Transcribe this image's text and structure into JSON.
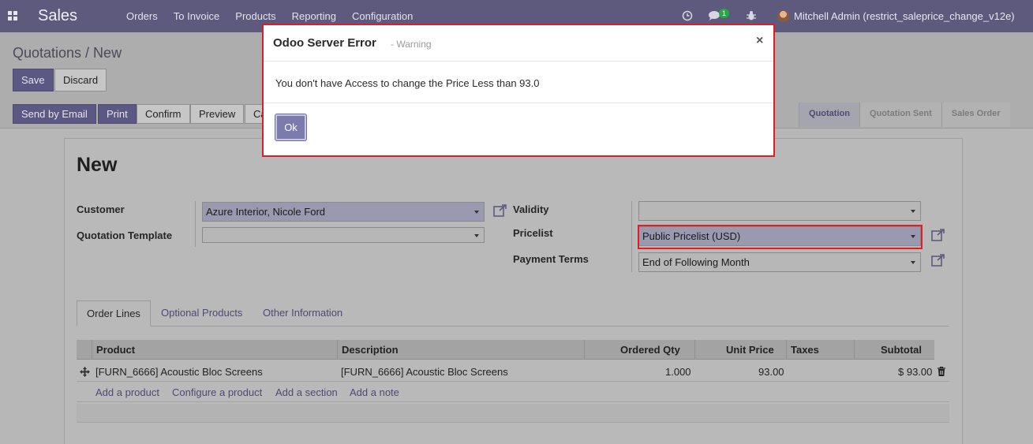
{
  "navbar": {
    "brand": "Sales",
    "menu": [
      "Orders",
      "To Invoice",
      "Products",
      "Reporting",
      "Configuration"
    ],
    "message_count": "1",
    "user": "Mitchell Admin (restrict_saleprice_change_v12e)"
  },
  "breadcrumb": "Quotations / New",
  "buttons": {
    "save": "Save",
    "discard": "Discard",
    "send_email": "Send by Email",
    "print": "Print",
    "confirm": "Confirm",
    "preview": "Preview",
    "cancel_partial": "Ca"
  },
  "statusbar": [
    "Quotation",
    "Quotation Sent",
    "Sales Order"
  ],
  "form": {
    "title": "New",
    "customer_label": "Customer",
    "customer_value": "Azure Interior, Nicole Ford",
    "template_label": "Quotation Template",
    "template_value": "",
    "validity_label": "Validity",
    "validity_value": "",
    "pricelist_label": "Pricelist",
    "pricelist_value": "Public Pricelist (USD)",
    "payment_label": "Payment Terms",
    "payment_value": "End of Following Month"
  },
  "tabs": [
    "Order Lines",
    "Optional Products",
    "Other Information"
  ],
  "table": {
    "headers": [
      "Product",
      "Description",
      "Ordered Qty",
      "Unit Price",
      "Taxes",
      "Subtotal"
    ],
    "rows": [
      {
        "product": "[FURN_6666] Acoustic Bloc Screens",
        "description": "[FURN_6666] Acoustic Bloc Screens",
        "qty": "1.000",
        "price": "93.00",
        "taxes": "",
        "subtotal": "$ 93.00"
      }
    ],
    "add_links": [
      "Add a product",
      "Configure a product",
      "Add a section",
      "Add a note"
    ]
  },
  "modal": {
    "title": "Odoo Server Error",
    "subtitle": "- Warning",
    "close": "×",
    "message": "You don't have Access to change the Price Less than 93.0",
    "ok": "Ok"
  },
  "colors": {
    "navbar": "#5d5a7e",
    "primary": "#7c7bad",
    "highlight_border": "#e01c24"
  }
}
